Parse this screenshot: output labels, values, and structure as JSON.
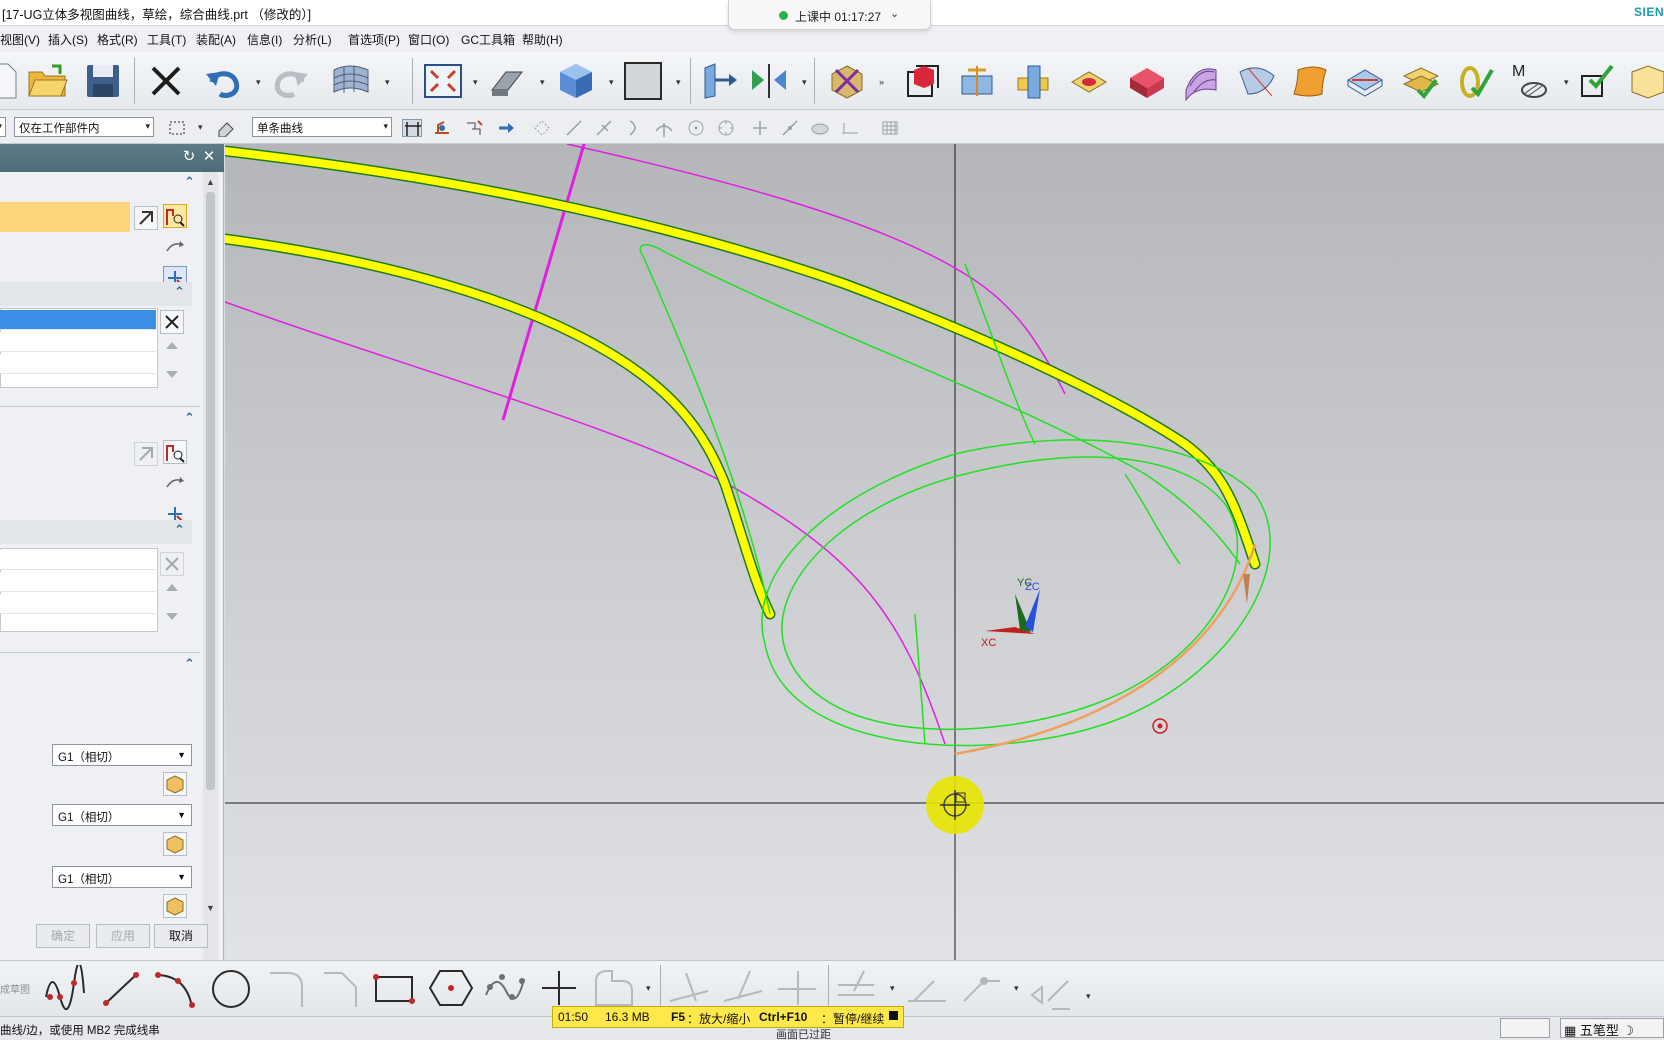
{
  "window": {
    "title": "[17-UG立体多视图曲线，草绘，综合曲线.prt （修改的）]",
    "brand": "SIEN",
    "session": "上课中 01:17:27"
  },
  "menu": [
    "视图(V)",
    "插入(S)",
    "格式(R)",
    "工具(T)",
    "装配(A)",
    "信息(I)",
    "分析(L)",
    "首选项(P)",
    "窗口(O)",
    "GC工具箱",
    "帮助(H)"
  ],
  "selection_bar": {
    "scope_filter": "仅在工作部件内",
    "curve_rule": "单条曲线"
  },
  "dialog": {
    "continuity": [
      "G1（相切）",
      "G1（相切）",
      "G1（相切）"
    ],
    "buttons": {
      "ok": "确定",
      "apply": "应用",
      "cancel": "取消"
    }
  },
  "viewport": {
    "axes": {
      "x": "XC",
      "y": "YC",
      "z": "ZC"
    },
    "colors": {
      "selected_curve": "#ffff00",
      "curve_green": "#22e022",
      "curve_magenta": "#e020e0",
      "curve_orange": "#f0a060",
      "background_top": "#b4b6b9",
      "background_bottom": "#e0e2e5"
    }
  },
  "bottom_toolbar": {
    "label": "成草图",
    "icons": [
      "studio-spline-icon",
      "line-icon",
      "arc-icon",
      "circle-icon",
      "fillet-icon",
      "chamfer-icon",
      "rectangle-icon",
      "polygon-icon",
      "fit-spline-icon",
      "point-icon",
      "profile-icon",
      "trim-icon",
      "extend-icon",
      "make-corner-icon",
      "offset-icon",
      "mirror-icon",
      "project-icon"
    ]
  },
  "status": {
    "prompt": "曲线/边，或使用 MB2 完成线串",
    "secondary": "画面已过距",
    "recorder": {
      "time": "01:50",
      "size": "16.3 MB",
      "hint1_key": "F5",
      "hint1_text": "：放大/缩小",
      "hint2_key": "Ctrl+F10",
      "hint2_text": "：暂停/继续"
    },
    "ime": "五笔型"
  }
}
